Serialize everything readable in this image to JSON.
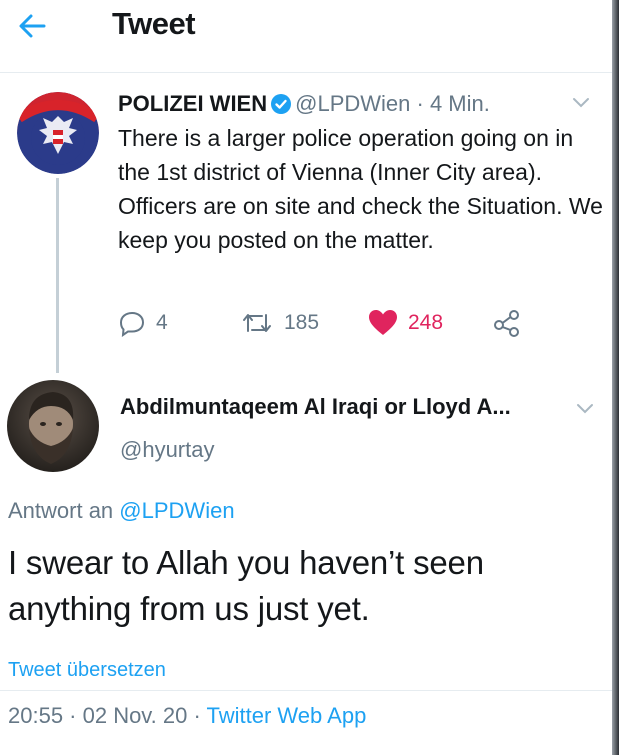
{
  "header": {
    "title": "Tweet"
  },
  "parent_tweet": {
    "author_name": "POLIZEI WIEN",
    "handle": "@LPDWien",
    "time": "· 4 Min.",
    "body": "There is a larger police operation going on in the 1st district of Vienna (Inner City area). Officers are on site and check the Situation. We keep you posted on the matter.",
    "replies": "4",
    "retweets": "185",
    "likes": "248"
  },
  "reply": {
    "author_name": "Abdilmuntaqeem Al Iraqi or Lloyd A...",
    "handle": "@hyurtay",
    "reply_to_prefix": "Antwort an",
    "reply_to_handle": "@LPDWien",
    "text": "I swear to Allah you haven’t seen anything from us just yet.",
    "translate": "Tweet übersetzen",
    "timestamp": "20:55 · 02 Nov. 20 · ",
    "client": "Twitter Web App"
  },
  "colors": {
    "accent": "#1da1f2",
    "like": "#e0245e",
    "muted": "#657786"
  },
  "icons": [
    "back-arrow-icon",
    "verified-badge-icon",
    "chevron-down-icon",
    "reply-icon",
    "retweet-icon",
    "heart-icon",
    "share-icon"
  ]
}
